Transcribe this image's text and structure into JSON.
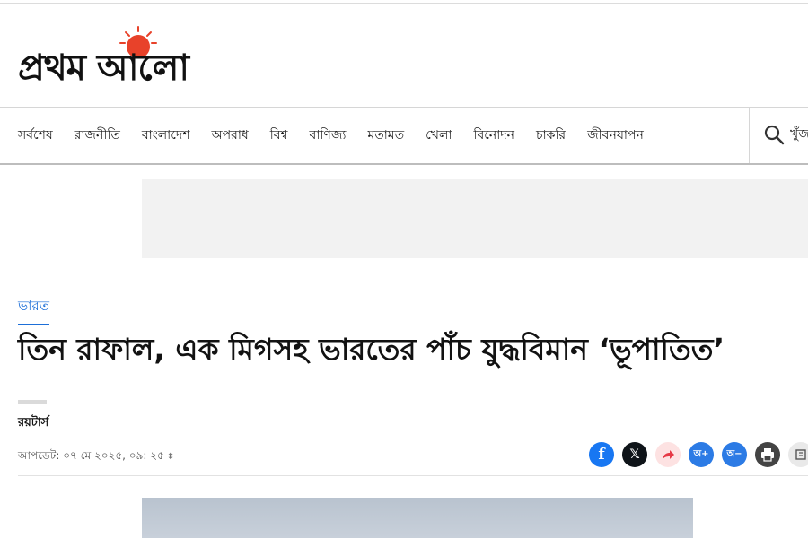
{
  "brand": {
    "name": "প্রথম আলো",
    "sun_color": "#e8422a"
  },
  "nav": {
    "items": [
      "সর্বশেষ",
      "রাজনীতি",
      "বাংলাদেশ",
      "অপরাধ",
      "বিশ্ব",
      "বাণিজ্য",
      "মতামত",
      "খেলা",
      "বিনোদন",
      "চাকরি",
      "জীবনযাপন"
    ],
    "search_label": "খুঁজ"
  },
  "article": {
    "section": "ভারত",
    "headline": "তিন রাফাল, এক মিগসহ ভারতের পাঁচ যুদ্ধবিমান ‘ভূপাতিত’",
    "author": "রয়টার্স",
    "updated": "আপডেট: ০৭ মে ২০২৫, ০৯: ২৫",
    "share": {
      "icons": [
        "facebook-icon",
        "x-icon",
        "share-icon",
        "font-increase-icon",
        "font-decrease-icon",
        "print-icon",
        "more-icon"
      ],
      "font_plus": "অ+",
      "font_minus": "অ−"
    }
  },
  "colors": {
    "accent": "#1d6fd8",
    "facebook": "#1877f2",
    "x": "#0f1419",
    "share": "#fde2e2"
  }
}
